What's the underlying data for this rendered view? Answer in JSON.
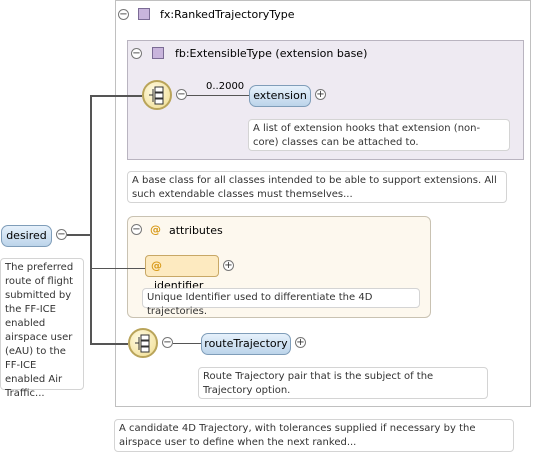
{
  "root": {
    "name": "desired",
    "note": "The preferred route of flight submitted by the FF-ICE enabled airspace user (eAU) to the FF-ICE enabled Air Traffic..."
  },
  "type": {
    "name": "fx:RankedTrajectoryType",
    "note": "A candidate 4D Trajectory, with tolerances supplied if necessary by the airspace user to define when the next ranked..."
  },
  "base": {
    "name": "fb:ExtensibleType (extension base)",
    "note": "A base class for all classes intended to be able to support extensions. All such extendable classes must themselves...",
    "element": {
      "name": "extension",
      "cardinality": "0..2000",
      "note": "A list of extension hooks that extension (non-core) classes can be attached to."
    }
  },
  "attributes": {
    "title": "attributes",
    "at_symbol": "@",
    "item": {
      "name": "identifier",
      "note": "Unique Identifier used to differentiate the 4D trajectories."
    }
  },
  "route": {
    "name": "routeTrajectory",
    "note": "Route Trajectory pair that is the subject of the Trajectory option."
  },
  "icons": {
    "collapse": "−",
    "expand": "+",
    "sequence": "sequence-compositor-icon",
    "complex_type": "complex-type-icon"
  }
}
